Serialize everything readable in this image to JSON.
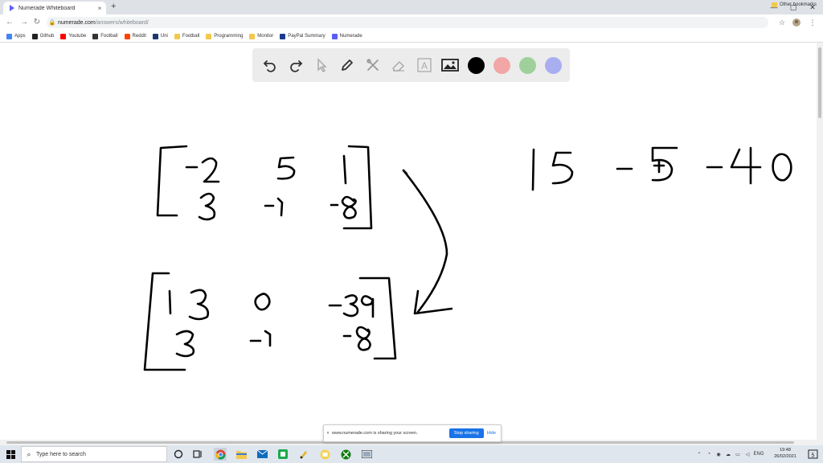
{
  "browser": {
    "tab_title": "Numerade Whiteboard",
    "tab_close": "×",
    "new_tab": "+",
    "url_host": "numerade.com",
    "url_path": "/answers/whiteboard/",
    "win_minimize": "—",
    "win_maximize": "▢",
    "win_close": "✕"
  },
  "bookmarks": {
    "items": [
      {
        "label": "Apps",
        "color": "#4285f4"
      },
      {
        "label": "Github",
        "color": "#222222"
      },
      {
        "label": "Youtube",
        "color": "#ff0000"
      },
      {
        "label": "Football",
        "color": "#333333"
      },
      {
        "label": "Reddit",
        "color": "#ff4500"
      },
      {
        "label": "Uni",
        "color": "#1a3a6b"
      },
      {
        "label": "Football",
        "color": "#f2c94c"
      },
      {
        "label": "Programming",
        "color": "#f2c94c"
      },
      {
        "label": "Monitor",
        "color": "#f2c94c"
      },
      {
        "label": "PayPal Summary",
        "color": "#1a3a8f"
      },
      {
        "label": "Numerade",
        "color": "#5b5ef5"
      }
    ],
    "other": "Other bookmarks"
  },
  "whiteboard": {
    "colors": [
      "#000000",
      "#f2a6a6",
      "#9fd09a",
      "#a8aef0"
    ]
  },
  "share_banner": {
    "message": "www.numerade.com is sharing your screen.",
    "stop": "Stop sharing",
    "hide": "Hide"
  },
  "taskbar": {
    "search_placeholder": "Type here to search",
    "language": "ENG",
    "time": "19:48",
    "date": "26/02/2021",
    "notifications": "5"
  }
}
